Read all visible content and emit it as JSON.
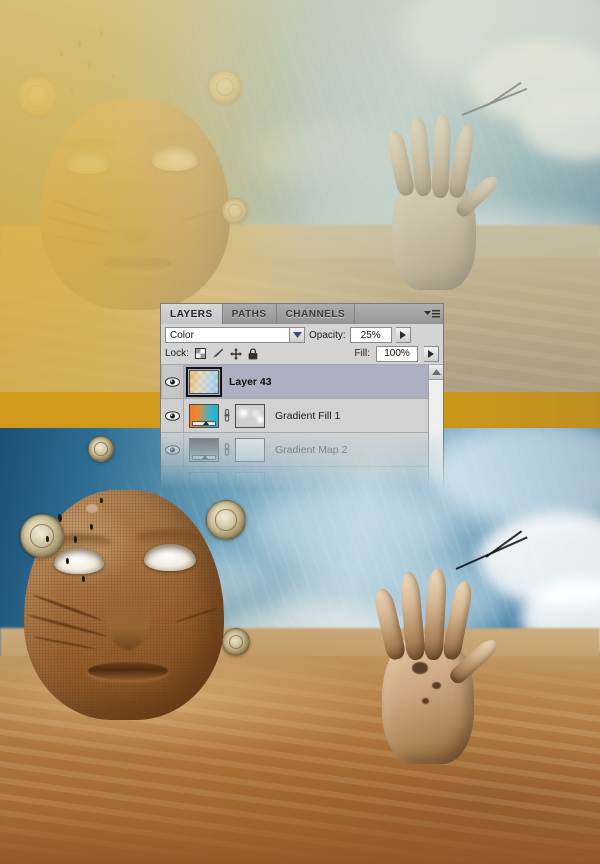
{
  "app": {
    "name": "Adobe Photoshop",
    "panel_title": "Layers Panel"
  },
  "panel": {
    "tabs": [
      {
        "label": "LAYERS",
        "active": true
      },
      {
        "label": "PATHS",
        "active": false
      },
      {
        "label": "CHANNELS",
        "active": false
      }
    ],
    "menu_icon": "panel-menu-icon",
    "blend_mode": {
      "value": "Color",
      "arrow_icon": "chevron-down-icon"
    },
    "opacity": {
      "label": "Opacity:",
      "value": "25%",
      "arrow_icon": "triangle-right-icon"
    },
    "fill": {
      "label": "Fill:",
      "value": "100%",
      "arrow_icon": "triangle-right-icon"
    },
    "lock": {
      "label": "Lock:",
      "items": [
        {
          "icon": "lock-transparent-pixels-icon",
          "title": "Lock transparent pixels"
        },
        {
          "icon": "lock-image-pixels-brush-icon",
          "title": "Lock image pixels"
        },
        {
          "icon": "lock-position-move-icon",
          "title": "Lock position"
        },
        {
          "icon": "lock-all-padlock-icon",
          "title": "Lock all"
        }
      ]
    },
    "layers": [
      {
        "name": "Layer 43",
        "selected": true,
        "visible": true,
        "eye_icon": "eye-icon",
        "thumb": "checkerboard-gradient-thumbnail",
        "has_mask": false,
        "has_link": false,
        "faded": false
      },
      {
        "name": "Gradient Fill 1",
        "selected": false,
        "visible": true,
        "eye_icon": "eye-icon",
        "thumb": "orange-cyan-gradient-thumbnail",
        "has_mask": true,
        "mask_thumb": "soft-white-blobs-mask",
        "has_link": true,
        "link_icon": "link-chain-icon",
        "faded": false
      },
      {
        "name": "Gradient Map 2",
        "selected": false,
        "visible": true,
        "eye_icon": "eye-icon",
        "thumb": "black-white-gradient-thumbnail",
        "has_mask": true,
        "mask_thumb": "empty-white-mask",
        "has_link": true,
        "link_icon": "link-chain-icon",
        "faded": true
      }
    ],
    "scrollbar": {
      "up_arrow_icon": "scroll-up-arrow-icon"
    }
  },
  "colors": {
    "panel_bg": "#d4d4d4",
    "panel_border": "#7a7a7a",
    "row_selected": "#adb0c0",
    "tab_active": "#d8d8d8",
    "gradient_fill_start": "#ef7f2a",
    "gradient_fill_end": "#17b4d4",
    "gold_band": "#d0991a"
  },
  "artwork": {
    "top_half_label": "before-color-grade-preview",
    "bottom_half_label": "after-color-grade-preview",
    "elements": [
      "buried-stone-face",
      "emerging-hand",
      "floating-pocket-watches",
      "desert-dunes",
      "cloudy-sky",
      "flying-debris"
    ]
  }
}
